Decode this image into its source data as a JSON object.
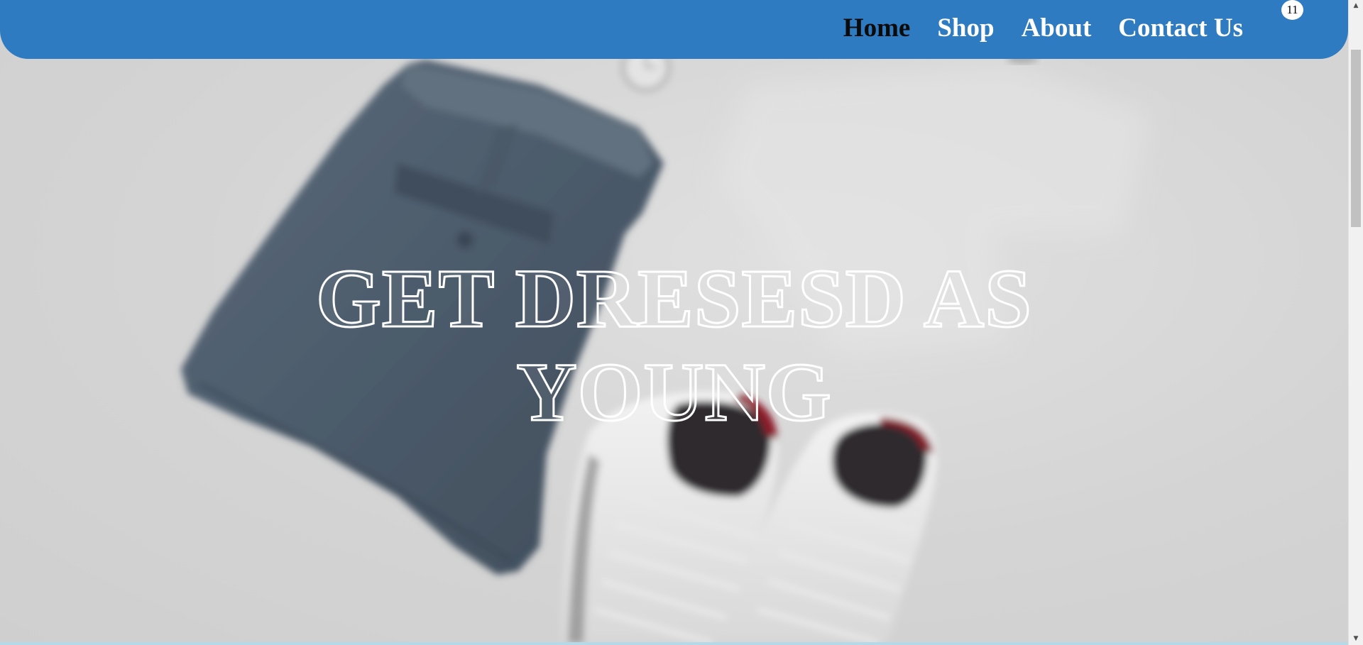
{
  "navbar": {
    "links": [
      {
        "label": "Home",
        "active": true
      },
      {
        "label": "Shop",
        "active": false
      },
      {
        "label": "About",
        "active": false
      },
      {
        "label": "Contact Us",
        "active": false
      }
    ],
    "cart": {
      "icon": "cart-icon",
      "count": "11",
      "color": "#4a1aa8"
    },
    "background_color": "#2f7bc1"
  },
  "hero": {
    "title_line1": "GET DRESESD AS",
    "title_line2": "YOUNG",
    "background_color": "#d6d6d6"
  }
}
